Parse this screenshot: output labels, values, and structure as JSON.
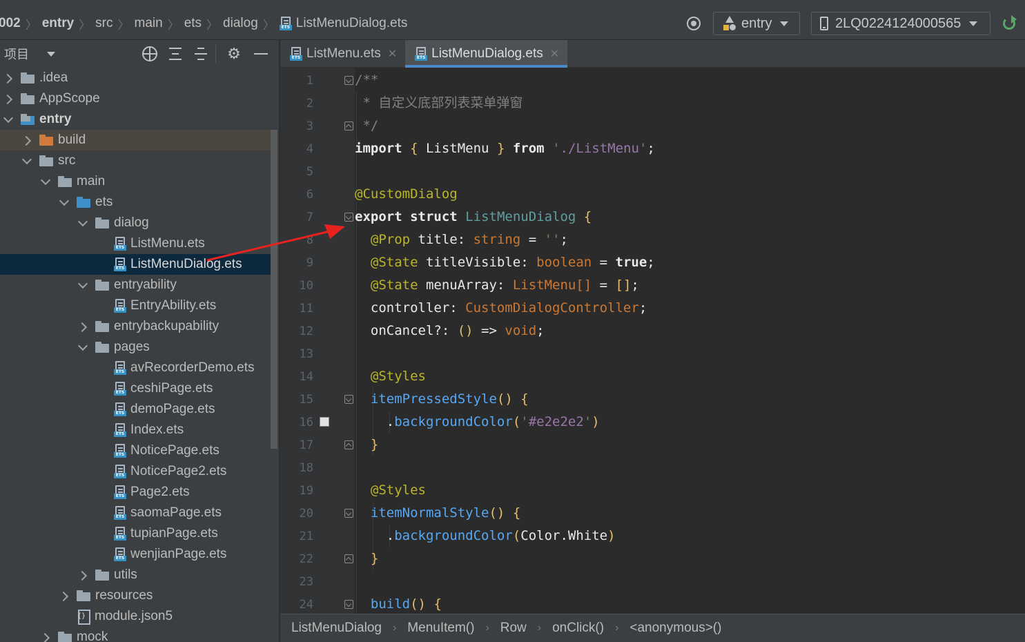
{
  "breadcrumb": [
    "002",
    "entry",
    "src",
    "main",
    "ets",
    "dialog",
    "ListMenuDialog.ets"
  ],
  "toolbar": {
    "module_selector": "entry",
    "device_selector": "2LQ0224124000565"
  },
  "project_panel": {
    "title": "项目",
    "tree": [
      {
        "label": ".idea",
        "depth": 0,
        "state": "collapsed",
        "icon": "folder"
      },
      {
        "label": "AppScope",
        "depth": 0,
        "state": "collapsed",
        "icon": "folder"
      },
      {
        "label": "entry",
        "depth": 0,
        "state": "expanded",
        "icon": "module-folder",
        "bold": true
      },
      {
        "label": "build",
        "depth": 1,
        "state": "collapsed",
        "icon": "folder-orange",
        "highlight": "excluded"
      },
      {
        "label": "src",
        "depth": 1,
        "state": "expanded",
        "icon": "folder"
      },
      {
        "label": "main",
        "depth": 2,
        "state": "expanded",
        "icon": "folder"
      },
      {
        "label": "ets",
        "depth": 3,
        "state": "expanded",
        "icon": "folder-blue"
      },
      {
        "label": "dialog",
        "depth": 4,
        "state": "expanded",
        "icon": "folder"
      },
      {
        "label": "ListMenu.ets",
        "depth": 5,
        "state": "leaf",
        "icon": "ets-file"
      },
      {
        "label": "ListMenuDialog.ets",
        "depth": 5,
        "state": "leaf",
        "icon": "ets-file",
        "selected": true
      },
      {
        "label": "entryability",
        "depth": 4,
        "state": "expanded",
        "icon": "folder"
      },
      {
        "label": "EntryAbility.ets",
        "depth": 5,
        "state": "leaf",
        "icon": "ets-file"
      },
      {
        "label": "entrybackupability",
        "depth": 4,
        "state": "collapsed",
        "icon": "folder"
      },
      {
        "label": "pages",
        "depth": 4,
        "state": "expanded",
        "icon": "folder"
      },
      {
        "label": "avRecorderDemo.ets",
        "depth": 5,
        "state": "leaf",
        "icon": "ets-file"
      },
      {
        "label": "ceshiPage.ets",
        "depth": 5,
        "state": "leaf",
        "icon": "ets-file"
      },
      {
        "label": "demoPage.ets",
        "depth": 5,
        "state": "leaf",
        "icon": "ets-file"
      },
      {
        "label": "Index.ets",
        "depth": 5,
        "state": "leaf",
        "icon": "ets-file"
      },
      {
        "label": "NoticePage.ets",
        "depth": 5,
        "state": "leaf",
        "icon": "ets-file"
      },
      {
        "label": "NoticePage2.ets",
        "depth": 5,
        "state": "leaf",
        "icon": "ets-file"
      },
      {
        "label": "Page2.ets",
        "depth": 5,
        "state": "leaf",
        "icon": "ets-file"
      },
      {
        "label": "saomaPage.ets",
        "depth": 5,
        "state": "leaf",
        "icon": "ets-file"
      },
      {
        "label": "tupianPage.ets",
        "depth": 5,
        "state": "leaf",
        "icon": "ets-file"
      },
      {
        "label": "wenjianPage.ets",
        "depth": 5,
        "state": "leaf",
        "icon": "ets-file"
      },
      {
        "label": "utils",
        "depth": 4,
        "state": "collapsed",
        "icon": "folder"
      },
      {
        "label": "resources",
        "depth": 3,
        "state": "collapsed",
        "icon": "folder"
      },
      {
        "label": "module.json5",
        "depth": 3,
        "state": "leaf",
        "icon": "json-file"
      },
      {
        "label": "mock",
        "depth": 2,
        "state": "collapsed",
        "icon": "folder"
      }
    ]
  },
  "editor": {
    "tabs": [
      {
        "label": "ListMenu.ets",
        "active": false
      },
      {
        "label": "ListMenuDialog.ets",
        "active": true
      }
    ],
    "lines": [
      {
        "n": "1",
        "tokens": [
          [
            "cm",
            "/**"
          ]
        ]
      },
      {
        "n": "2",
        "tokens": [
          [
            "cm",
            " * 自定义底部列表菜单弹窗"
          ]
        ]
      },
      {
        "n": "3",
        "tokens": [
          [
            "cm",
            " */"
          ]
        ]
      },
      {
        "n": "4",
        "tokens": [
          [
            "kw2",
            "import"
          ],
          [
            "pl",
            " "
          ],
          [
            "br",
            "{"
          ],
          [
            "pl",
            " ListMenu "
          ],
          [
            "br",
            "}"
          ],
          [
            "pl",
            " "
          ],
          [
            "kw2",
            "from"
          ],
          [
            "pl",
            " "
          ],
          [
            "str",
            "'"
          ],
          [
            "strp",
            "./ListMenu"
          ],
          [
            "str",
            "'"
          ],
          [
            "pl",
            ";"
          ]
        ]
      },
      {
        "n": "5",
        "tokens": []
      },
      {
        "n": "6",
        "tokens": [
          [
            "dec",
            "@CustomDialog"
          ]
        ]
      },
      {
        "n": "7",
        "tokens": [
          [
            "kw2",
            "export"
          ],
          [
            "pl",
            " "
          ],
          [
            "kw2",
            "struct"
          ],
          [
            "pl",
            " "
          ],
          [
            "cls",
            "ListMenuDialog"
          ],
          [
            "pl",
            " "
          ],
          [
            "br",
            "{"
          ]
        ]
      },
      {
        "n": "8",
        "tokens": [
          [
            "pl",
            "  "
          ],
          [
            "dec",
            "@Prop"
          ],
          [
            "pl",
            " title: "
          ],
          [
            "ty",
            "string"
          ],
          [
            "pl",
            " = "
          ],
          [
            "str",
            "''"
          ],
          [
            "pl",
            ";"
          ]
        ]
      },
      {
        "n": "9",
        "tokens": [
          [
            "pl",
            "  "
          ],
          [
            "dec",
            "@State"
          ],
          [
            "pl",
            " titleVisible: "
          ],
          [
            "ty",
            "boolean"
          ],
          [
            "pl",
            " = "
          ],
          [
            "kw2",
            "true"
          ],
          [
            "pl",
            ";"
          ]
        ]
      },
      {
        "n": "10",
        "tokens": [
          [
            "pl",
            "  "
          ],
          [
            "dec",
            "@State"
          ],
          [
            "pl",
            " menuArray: "
          ],
          [
            "ty",
            "ListMenu[]"
          ],
          [
            "pl",
            " = "
          ],
          [
            "br",
            "[]"
          ],
          [
            "pl",
            ";"
          ]
        ]
      },
      {
        "n": "11",
        "tokens": [
          [
            "pl",
            "  controller: "
          ],
          [
            "ty",
            "CustomDialogController"
          ],
          [
            "pl",
            ";"
          ]
        ]
      },
      {
        "n": "12",
        "tokens": [
          [
            "pl",
            "  onCancel?: "
          ],
          [
            "br",
            "()"
          ],
          [
            "pl",
            " => "
          ],
          [
            "ty",
            "void"
          ],
          [
            "pl",
            ";"
          ]
        ]
      },
      {
        "n": "13",
        "tokens": []
      },
      {
        "n": "14",
        "tokens": [
          [
            "pl",
            "  "
          ],
          [
            "dec",
            "@Styles"
          ]
        ]
      },
      {
        "n": "15",
        "tokens": [
          [
            "pl",
            "  "
          ],
          [
            "fn",
            "itemPressedStyle"
          ],
          [
            "br",
            "()"
          ],
          [
            "pl",
            " "
          ],
          [
            "br",
            "{"
          ]
        ]
      },
      {
        "n": "16",
        "tokens": [
          [
            "pl",
            "    ."
          ],
          [
            "fn",
            "backgroundColor"
          ],
          [
            "br",
            "("
          ],
          [
            "str",
            "'"
          ],
          [
            "strp",
            "#e2e2e2"
          ],
          [
            "str",
            "'"
          ],
          [
            "br",
            ")"
          ]
        ]
      },
      {
        "n": "17",
        "tokens": [
          [
            "pl",
            "  "
          ],
          [
            "br",
            "}"
          ]
        ]
      },
      {
        "n": "18",
        "tokens": []
      },
      {
        "n": "19",
        "tokens": [
          [
            "pl",
            "  "
          ],
          [
            "dec",
            "@Styles"
          ]
        ]
      },
      {
        "n": "20",
        "tokens": [
          [
            "pl",
            "  "
          ],
          [
            "fn",
            "itemNormalStyle"
          ],
          [
            "br",
            "()"
          ],
          [
            "pl",
            " "
          ],
          [
            "br",
            "{"
          ]
        ]
      },
      {
        "n": "21",
        "tokens": [
          [
            "pl",
            "    ."
          ],
          [
            "fn",
            "backgroundColor"
          ],
          [
            "br",
            "("
          ],
          [
            "pl",
            "Color.White"
          ],
          [
            "br",
            ")"
          ]
        ]
      },
      {
        "n": "22",
        "tokens": [
          [
            "pl",
            "  "
          ],
          [
            "br",
            "}"
          ]
        ]
      },
      {
        "n": "23",
        "tokens": []
      },
      {
        "n": "24",
        "tokens": [
          [
            "pl",
            "  "
          ],
          [
            "fn",
            "build"
          ],
          [
            "br",
            "()"
          ],
          [
            "pl",
            " "
          ],
          [
            "br",
            "{"
          ]
        ]
      }
    ]
  },
  "status_breadcrumb": [
    "ListMenuDialog",
    "MenuItem()",
    "Row",
    "onClick()",
    "<anonymous>()"
  ],
  "colors": {
    "accent": "#4a88c7",
    "selection": "#0d293e",
    "annotation_arrow": "#e8231f"
  }
}
